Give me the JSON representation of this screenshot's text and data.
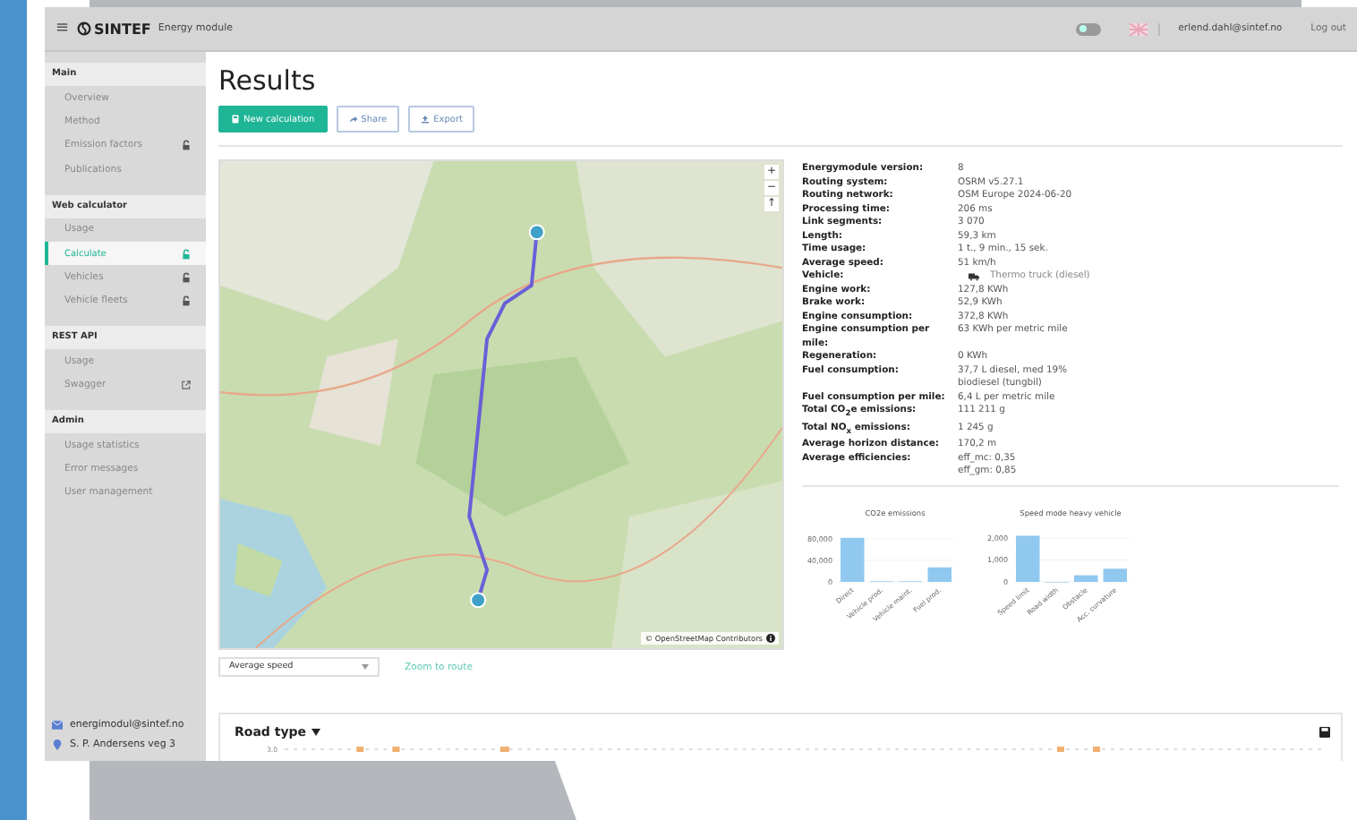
{
  "header": {
    "menu_glyph": "≡",
    "brand": "SINTEF",
    "module": "Energy module",
    "theme_toggle": {
      "on": false
    },
    "user": "erlend.dahl@sintef.no",
    "logout": "Log out"
  },
  "sidebar": {
    "sections": [
      {
        "title": "Main",
        "items": [
          {
            "label": "Overview",
            "kind": "plain",
            "selected": false
          },
          {
            "label": "Method",
            "kind": "plain",
            "selected": false
          },
          {
            "label": "Emission factors",
            "kind": "locked",
            "selected": false
          },
          {
            "label": "Publications",
            "kind": "plain",
            "selected": false
          }
        ]
      },
      {
        "title": "Web calculator",
        "items": [
          {
            "label": "Usage",
            "kind": "plain",
            "selected": false
          },
          {
            "label": "Calculate",
            "kind": "locked",
            "selected": true
          },
          {
            "label": "Vehicles",
            "kind": "locked",
            "selected": false
          },
          {
            "label": "Vehicle fleets",
            "kind": "locked",
            "selected": false
          }
        ]
      },
      {
        "title": "REST API",
        "items": [
          {
            "label": "Usage",
            "kind": "plain",
            "selected": false
          },
          {
            "label": "Swagger",
            "kind": "external",
            "selected": false
          }
        ]
      },
      {
        "title": "Admin",
        "items": [
          {
            "label": "Usage statistics",
            "kind": "plain",
            "selected": false
          },
          {
            "label": "Error messages",
            "kind": "plain",
            "selected": false
          },
          {
            "label": "User management",
            "kind": "plain",
            "selected": false
          }
        ]
      }
    ],
    "contact": {
      "email": "energimodul@sintef.no",
      "address": "S. P. Andersens veg 3"
    }
  },
  "page": {
    "title": "Results",
    "buttons": [
      {
        "label": "New calculation",
        "kind": "primary"
      },
      {
        "label": "Share",
        "kind": "share"
      },
      {
        "label": "Export",
        "kind": "export"
      }
    ]
  },
  "map": {
    "controls": [
      "+",
      "−",
      "↑"
    ],
    "attribution": "© OpenStreetMap Contributors"
  },
  "map_options": {
    "select": "Average speed",
    "link": "Zoom to route"
  },
  "details": [
    {
      "label": "Energymodule version:",
      "values": [
        "8"
      ]
    },
    {
      "label": "Routing system:",
      "values": [
        "OSRM v5.27.1"
      ]
    },
    {
      "label": "Routing network:",
      "values": [
        "OSM Europe 2024-06-20"
      ]
    },
    {
      "label": "Processing time:",
      "values": [
        "206 ms"
      ]
    },
    {
      "label": "Link segments:",
      "values": [
        "3 070"
      ]
    },
    {
      "label": "Length:",
      "values": [
        "59,3 km"
      ]
    },
    {
      "label": "Time usage:",
      "values": [
        "1 t., 9 min., 15 sek."
      ]
    },
    {
      "label": "Average speed:",
      "values": [
        "51 km/h"
      ]
    },
    {
      "label": "Vehicle:",
      "values": [
        "Thermo truck (diesel)"
      ],
      "kind": "vehicle"
    },
    {
      "label": "Engine work:",
      "values": [
        "127,8 KWh"
      ]
    },
    {
      "label": "Brake work:",
      "values": [
        "52,9 KWh"
      ]
    },
    {
      "label": "Engine consumption:",
      "values": [
        "372,8 KWh"
      ]
    },
    {
      "label": "Engine consumption per mile:",
      "values": [
        "63 KWh per metric mile"
      ]
    },
    {
      "label": "Regeneration:",
      "values": [
        "0 KWh"
      ]
    },
    {
      "label": "Fuel consumption:",
      "values": [
        "37,7 L diesel, med 19% biodiesel (tungbil)"
      ]
    },
    {
      "label": "Fuel consumption per mile:",
      "values": [
        "6,4 L per metric mile"
      ]
    },
    {
      "label": "Total CO$_{2}$e emissions:",
      "values": [
        "111 211 g"
      ]
    },
    {
      "label": "Total NO$_{x}$ emissions:",
      "values": [
        "1 245 g"
      ]
    },
    {
      "label": "Average horizon distance:",
      "values": [
        "170,2 m"
      ]
    },
    {
      "label": "Average efficiencies:",
      "values": [
        "eff_mc: 0,35",
        "eff_gm: 0,85"
      ]
    }
  ],
  "charts": [
    {
      "chart_data": {
        "type": "bar",
        "title": "CO2e emissions",
        "categories": [
          "Direct",
          "Vehicle prod.",
          "Vehicle maint.",
          "Fuel prod."
        ],
        "series": [
          {
            "color": "#90c8f0",
            "values": [
              82000,
              1000,
              1000,
              27000
            ]
          }
        ],
        "ylim": [
          0,
          90000
        ],
        "yticks": [
          {
            "value": 0,
            "label": "0"
          },
          {
            "value": 40000,
            "label": "40,000"
          },
          {
            "value": 80000,
            "label": "80,000"
          }
        ]
      }
    },
    {
      "chart_data": {
        "type": "bar",
        "title": "Speed mode heavy vehicle",
        "categories": [
          "Speed limit",
          "Road width",
          "Obstacle",
          "Acc. curvature"
        ],
        "series": [
          {
            "color": "#90c8f0",
            "values": [
              2100,
              0,
              300,
              600
            ]
          }
        ],
        "ylim": [
          0,
          2200
        ],
        "yticks": [
          {
            "value": 0,
            "label": "0"
          },
          {
            "value": 1000,
            "label": "1,000"
          },
          {
            "value": 2000,
            "label": "2,000"
          }
        ]
      }
    }
  ],
  "road_type": {
    "title": "Road type",
    "y_tick": "3.0"
  }
}
